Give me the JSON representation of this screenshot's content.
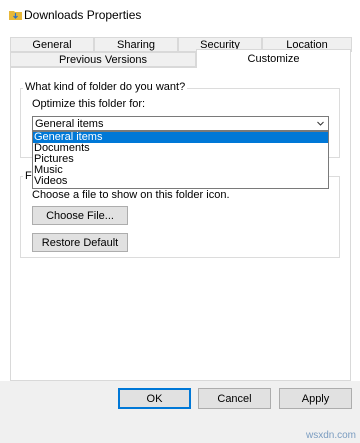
{
  "window": {
    "title": "Downloads Properties"
  },
  "tabs_row1": [
    "General",
    "Sharing",
    "Security",
    "Location"
  ],
  "tabs_row2": [
    "Previous Versions",
    "Customize"
  ],
  "section": {
    "question": "What kind of folder do you want?",
    "optimize_label": "Optimize this folder for:",
    "selected": "General items",
    "options": [
      "General items",
      "Documents",
      "Pictures",
      "Music",
      "Videos"
    ]
  },
  "folder_pictures": {
    "legend_partial": "F",
    "hint": "Choose a file to show on this folder icon.",
    "choose_file": "Choose File...",
    "restore_default": "Restore Default"
  },
  "footer": {
    "ok": "OK",
    "cancel": "Cancel",
    "apply": "Apply"
  },
  "watermark": "wsxdn.com",
  "colors": {
    "accent": "#0078d7",
    "folder": "#e8b83a"
  },
  "icons": {
    "title": "folder-download-icon",
    "combo": "chevron-down-icon"
  }
}
